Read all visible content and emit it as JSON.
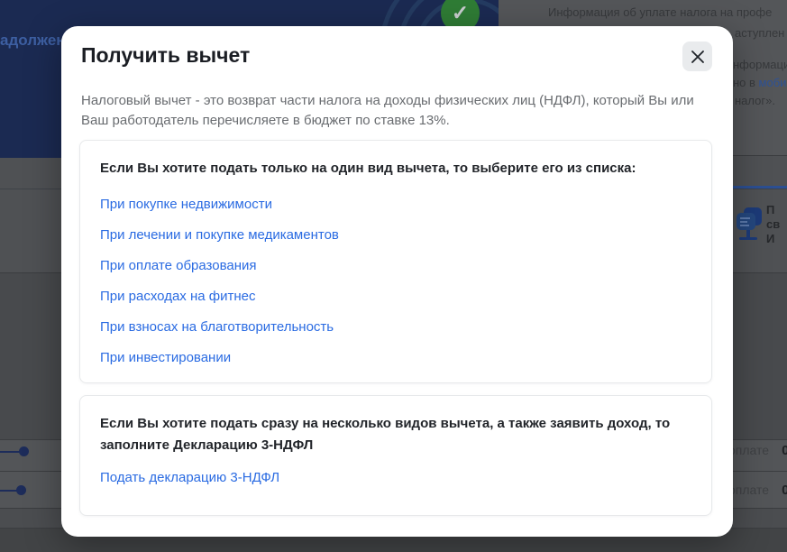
{
  "modal": {
    "title": "Получить вычет",
    "description": "Налоговый вычет - это возврат части налога на доходы физических лиц (НДФЛ), который Вы или Ваш работодатель перечисляете в бюджет по ставке 13%.",
    "single_card": {
      "heading": "Если Вы хотите подать только на один вид вычета, то выберите его из списка:",
      "links": [
        "При покупке недвижимости",
        "При лечении и покупке медикаментов",
        "При оплате образования",
        "При расходах на фитнес",
        "При взносах на благотворительность",
        "При инвестировании"
      ]
    },
    "multi_card": {
      "heading": "Если Вы хотите подать сразу на несколько видов вычета, а также заявить доход, то заполните Декларацию 3-НДФЛ",
      "link": "Подать декларацию 3-НДФЛ"
    }
  },
  "background": {
    "navy_text_fragment": "адолжен",
    "check_mark": "✓",
    "info_line1": "Информация об уплате налога на профе",
    "fragment_line2": "аступлен",
    "fragment_line3": "нформаци",
    "fragment_line4_gray": "но в ",
    "fragment_line4_link": "моби",
    "fragment_line5": "налог».",
    "bold_fragment1": "П",
    "bold_fragment2": "св",
    "bold_fragment3": "И",
    "pay_rows": [
      {
        "label": "оплате",
        "value": "0"
      },
      {
        "label": "оплате",
        "value": "0"
      }
    ]
  },
  "colors": {
    "link_blue": "#2a6be2",
    "navy_panel": "#1b2a52",
    "badge_green": "#2f7c35",
    "modal_bg": "#ffffff",
    "close_bg": "#e9ebed"
  }
}
